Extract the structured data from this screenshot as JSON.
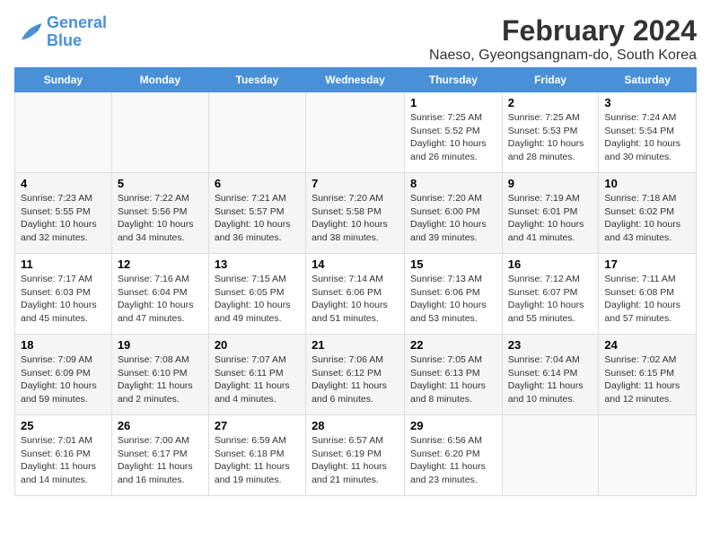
{
  "logo": {
    "line1": "General",
    "line2": "Blue"
  },
  "title": "February 2024",
  "subtitle": "Naeso, Gyeongsangnam-do, South Korea",
  "days_of_week": [
    "Sunday",
    "Monday",
    "Tuesday",
    "Wednesday",
    "Thursday",
    "Friday",
    "Saturday"
  ],
  "weeks": [
    [
      {
        "num": "",
        "info": ""
      },
      {
        "num": "",
        "info": ""
      },
      {
        "num": "",
        "info": ""
      },
      {
        "num": "",
        "info": ""
      },
      {
        "num": "1",
        "info": "Sunrise: 7:25 AM\nSunset: 5:52 PM\nDaylight: 10 hours\nand 26 minutes."
      },
      {
        "num": "2",
        "info": "Sunrise: 7:25 AM\nSunset: 5:53 PM\nDaylight: 10 hours\nand 28 minutes."
      },
      {
        "num": "3",
        "info": "Sunrise: 7:24 AM\nSunset: 5:54 PM\nDaylight: 10 hours\nand 30 minutes."
      }
    ],
    [
      {
        "num": "4",
        "info": "Sunrise: 7:23 AM\nSunset: 5:55 PM\nDaylight: 10 hours\nand 32 minutes."
      },
      {
        "num": "5",
        "info": "Sunrise: 7:22 AM\nSunset: 5:56 PM\nDaylight: 10 hours\nand 34 minutes."
      },
      {
        "num": "6",
        "info": "Sunrise: 7:21 AM\nSunset: 5:57 PM\nDaylight: 10 hours\nand 36 minutes."
      },
      {
        "num": "7",
        "info": "Sunrise: 7:20 AM\nSunset: 5:58 PM\nDaylight: 10 hours\nand 38 minutes."
      },
      {
        "num": "8",
        "info": "Sunrise: 7:20 AM\nSunset: 6:00 PM\nDaylight: 10 hours\nand 39 minutes."
      },
      {
        "num": "9",
        "info": "Sunrise: 7:19 AM\nSunset: 6:01 PM\nDaylight: 10 hours\nand 41 minutes."
      },
      {
        "num": "10",
        "info": "Sunrise: 7:18 AM\nSunset: 6:02 PM\nDaylight: 10 hours\nand 43 minutes."
      }
    ],
    [
      {
        "num": "11",
        "info": "Sunrise: 7:17 AM\nSunset: 6:03 PM\nDaylight: 10 hours\nand 45 minutes."
      },
      {
        "num": "12",
        "info": "Sunrise: 7:16 AM\nSunset: 6:04 PM\nDaylight: 10 hours\nand 47 minutes."
      },
      {
        "num": "13",
        "info": "Sunrise: 7:15 AM\nSunset: 6:05 PM\nDaylight: 10 hours\nand 49 minutes."
      },
      {
        "num": "14",
        "info": "Sunrise: 7:14 AM\nSunset: 6:06 PM\nDaylight: 10 hours\nand 51 minutes."
      },
      {
        "num": "15",
        "info": "Sunrise: 7:13 AM\nSunset: 6:06 PM\nDaylight: 10 hours\nand 53 minutes."
      },
      {
        "num": "16",
        "info": "Sunrise: 7:12 AM\nSunset: 6:07 PM\nDaylight: 10 hours\nand 55 minutes."
      },
      {
        "num": "17",
        "info": "Sunrise: 7:11 AM\nSunset: 6:08 PM\nDaylight: 10 hours\nand 57 minutes."
      }
    ],
    [
      {
        "num": "18",
        "info": "Sunrise: 7:09 AM\nSunset: 6:09 PM\nDaylight: 10 hours\nand 59 minutes."
      },
      {
        "num": "19",
        "info": "Sunrise: 7:08 AM\nSunset: 6:10 PM\nDaylight: 11 hours\nand 2 minutes."
      },
      {
        "num": "20",
        "info": "Sunrise: 7:07 AM\nSunset: 6:11 PM\nDaylight: 11 hours\nand 4 minutes."
      },
      {
        "num": "21",
        "info": "Sunrise: 7:06 AM\nSunset: 6:12 PM\nDaylight: 11 hours\nand 6 minutes."
      },
      {
        "num": "22",
        "info": "Sunrise: 7:05 AM\nSunset: 6:13 PM\nDaylight: 11 hours\nand 8 minutes."
      },
      {
        "num": "23",
        "info": "Sunrise: 7:04 AM\nSunset: 6:14 PM\nDaylight: 11 hours\nand 10 minutes."
      },
      {
        "num": "24",
        "info": "Sunrise: 7:02 AM\nSunset: 6:15 PM\nDaylight: 11 hours\nand 12 minutes."
      }
    ],
    [
      {
        "num": "25",
        "info": "Sunrise: 7:01 AM\nSunset: 6:16 PM\nDaylight: 11 hours\nand 14 minutes."
      },
      {
        "num": "26",
        "info": "Sunrise: 7:00 AM\nSunset: 6:17 PM\nDaylight: 11 hours\nand 16 minutes."
      },
      {
        "num": "27",
        "info": "Sunrise: 6:59 AM\nSunset: 6:18 PM\nDaylight: 11 hours\nand 19 minutes."
      },
      {
        "num": "28",
        "info": "Sunrise: 6:57 AM\nSunset: 6:19 PM\nDaylight: 11 hours\nand 21 minutes."
      },
      {
        "num": "29",
        "info": "Sunrise: 6:56 AM\nSunset: 6:20 PM\nDaylight: 11 hours\nand 23 minutes."
      },
      {
        "num": "",
        "info": ""
      },
      {
        "num": "",
        "info": ""
      }
    ]
  ]
}
